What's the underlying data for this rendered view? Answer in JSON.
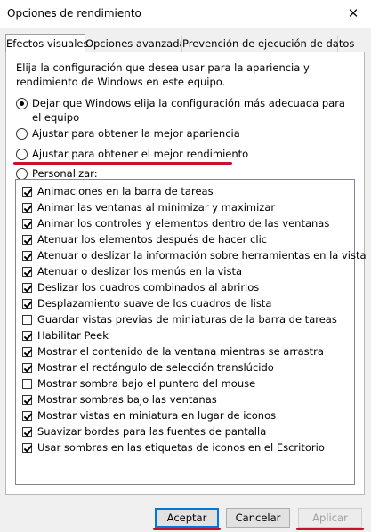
{
  "window": {
    "title": "Opciones de rendimiento",
    "close_glyph": "✕"
  },
  "tabs": [
    {
      "label": "Efectos visuales",
      "active": true
    },
    {
      "label": "Opciones avanzadas",
      "active": false
    },
    {
      "label": "Prevención de ejecución de datos",
      "active": false
    }
  ],
  "description": "Elija la configuración que desea usar para la apariencia y rendimiento de Windows en este equipo.",
  "radios": {
    "windows_choose": {
      "label": "Dejar que Windows elija la configuración más adecuada para el equipo",
      "checked": true
    },
    "best_appearance": {
      "label": "Ajustar para obtener la mejor apariencia",
      "checked": false
    },
    "best_performance": {
      "label": "Ajustar para obtener el mejor rendimiento",
      "checked": false
    },
    "custom": {
      "label": "Personalizar:",
      "checked": false
    }
  },
  "effects": [
    {
      "label": "Animaciones en la barra de tareas",
      "checked": true
    },
    {
      "label": "Animar las ventanas al minimizar y maximizar",
      "checked": true
    },
    {
      "label": "Animar los controles y elementos dentro de las ventanas",
      "checked": true
    },
    {
      "label": "Atenuar los elementos después de hacer clic",
      "checked": true
    },
    {
      "label": "Atenuar o deslizar la información sobre herramientas en la vista",
      "checked": true
    },
    {
      "label": "Atenuar o deslizar los menús en la vista",
      "checked": true
    },
    {
      "label": "Deslizar los cuadros combinados al abrirlos",
      "checked": true
    },
    {
      "label": "Desplazamiento suave de los cuadros de lista",
      "checked": true
    },
    {
      "label": "Guardar vistas previas de miniaturas de la barra de tareas",
      "checked": false
    },
    {
      "label": "Habilitar Peek",
      "checked": true
    },
    {
      "label": "Mostrar el contenido de la ventana mientras se arrastra",
      "checked": true
    },
    {
      "label": "Mostrar el rectángulo de selección translúcido",
      "checked": true
    },
    {
      "label": "Mostrar sombra bajo el puntero del mouse",
      "checked": false
    },
    {
      "label": "Mostrar sombras bajo las ventanas",
      "checked": true
    },
    {
      "label": "Mostrar vistas en miniatura en lugar de iconos",
      "checked": true
    },
    {
      "label": "Suavizar bordes para las fuentes de pantalla",
      "checked": true
    },
    {
      "label": "Usar sombras en las etiquetas de iconos en el Escritorio",
      "checked": true
    }
  ],
  "buttons": {
    "accept": "Aceptar",
    "cancel": "Cancelar",
    "apply": "Aplicar"
  },
  "colors": {
    "highlight_underline": "#c8102e",
    "default_button_border": "#0078d7"
  }
}
